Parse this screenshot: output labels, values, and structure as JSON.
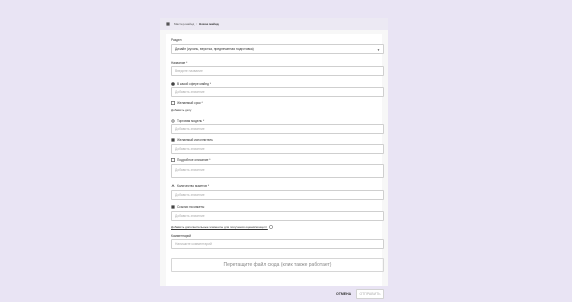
{
  "breadcrumb": {
    "parent": "Мастер-майнд",
    "separator": "/",
    "current": "Новое майнд"
  },
  "form": {
    "section": {
      "label": "Раздел",
      "value": "Дизайн (кухонь, верстка, предпечатная подготовка)"
    },
    "name": {
      "label": "Название *",
      "placeholder": "Введите название"
    },
    "task": {
      "label": "В какой сфере майнд *",
      "placeholder": "Добавить значение"
    },
    "deadline": {
      "label": "Желаемый срок *",
      "link": "Добавить дату"
    },
    "budget": {
      "label": "Торговая модель *",
      "placeholder": "Добавить значение"
    },
    "performer": {
      "label": "Желаемый исполнитель",
      "placeholder": "Добавить значение"
    },
    "details": {
      "label": "Подробное описание *",
      "placeholder": "Добавить значение"
    },
    "quantity": {
      "label": "Количество макетов *",
      "placeholder": "Добавить значение"
    },
    "references": {
      "label": "Ссылки на макеты",
      "placeholder": "Добавить значение"
    },
    "extra_link": "Добавить дополнительные элементы для получения оценки/концепт",
    "comment": {
      "label": "Комментарий",
      "placeholder": "Напишите комментарий"
    },
    "dropzone": "Перетащите файл сюда (клик также работает)"
  },
  "actions": {
    "cancel": "ОТМЕНА",
    "submit": "ОТПРАВИТЬ"
  }
}
